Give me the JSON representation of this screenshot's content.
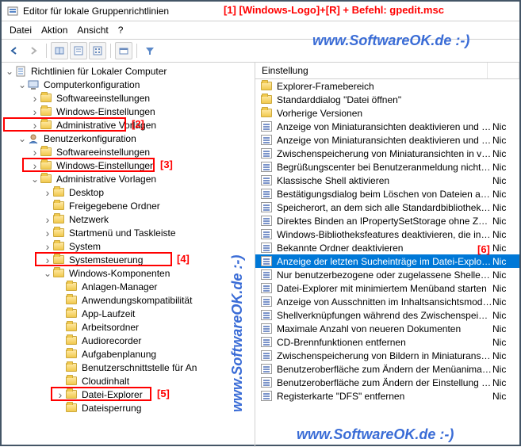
{
  "window": {
    "title": "Editor für lokale Gruppenrichtlinien"
  },
  "menu": {
    "file": "Datei",
    "action": "Aktion",
    "view": "Ansicht",
    "help": "?"
  },
  "instruction": "[1]  [Windows-Logo]+[R] + Befehl: gpedit.msc",
  "watermark": "www.SoftwareOK.de :-)",
  "hl": {
    "n2": "[2]",
    "n3": "[3]",
    "n4": "[4]",
    "n5": "[5]",
    "n6": "[6]"
  },
  "list_header": {
    "setting": "Einstellung"
  },
  "tree": {
    "root": "Richtlinien für Lokaler Computer",
    "cc": "Computerkonfiguration",
    "cc_soft": "Softwareeinstellungen",
    "cc_win": "Windows-Einstellungen",
    "cc_adm": "Administrative Vorlagen",
    "uc": "Benutzerkonfiguration",
    "uc_soft": "Softwareeinstellungen",
    "uc_win": "Windows-Einstellungen",
    "uc_adm": "Administrative Vorlagen",
    "desktop": "Desktop",
    "shared": "Freigegebene Ordner",
    "network": "Netzwerk",
    "start": "Startmenü und Taskleiste",
    "system": "System",
    "control": "Systemsteuerung",
    "wincomp": "Windows-Komponenten",
    "anlagen": "Anlagen-Manager",
    "appcompat": "Anwendungskompatibilität",
    "applaufzeit": "App-Laufzeit",
    "arbeitsordner": "Arbeitsordner",
    "audiorec": "Audiorecorder",
    "aufgaben": "Aufgabenplanung",
    "benschnitt": "Benutzerschnittstelle für An",
    "cloud": "Cloudinhalt",
    "explorer": "Datei-Explorer",
    "sperrung": "Dateisperrung"
  },
  "settings": [
    "Explorer-Framebereich",
    "Standarddialog \"Datei öffnen\"",
    "Vorherige Versionen",
    "Anzeige von Miniaturansichten deaktivieren und nur Symbo…",
    "Anzeige von Miniaturansichten deaktivieren und nur Symbo…",
    "Zwischenspeicherung von Miniaturansichten in versteckten …",
    "Begrüßungscenter bei Benutzeranmeldung nicht anzeigen",
    "Klassische Shell aktivieren",
    "Bestätigungsdialog beim Löschen von Dateien anzeigen",
    "Speicherort, an dem sich alle Standardbibliotheks-Definition…",
    "Direktes Binden an IPropertySetStorage ohne Zwischenschic…",
    "Windows-Bibliotheksfeatures deaktivieren, die indizierte Dat…",
    "Bekannte Ordner deaktivieren",
    "Anzeige der letzten Sucheinträge im Datei-Explorer-Suchfeld…",
    "Nur benutzerbezogene oder zugelassene Shellerweiterungen…",
    "Datei-Explorer mit minimiertem Menüband starten",
    "Anzeige von Ausschnitten im Inhaltsansichtsmodus deaktivi…",
    "Shellverknüpfungen während des Zwischenspeichern auf dem Serv…",
    "Maximale Anzahl von neueren Dokumenten",
    "CD-Brennfunktionen entfernen",
    "Zwischenspeicherung von Bildern in Miniaturansicht deakti…",
    "Benutzeroberfläche zum Ändern der Menüanimationseinstel…",
    "Benutzeroberfläche zum Ändern der Einstellung für Tastatur…",
    "Registerkarte \"DFS\" entfernen"
  ],
  "selected_index": 13,
  "state_short": "Nic"
}
